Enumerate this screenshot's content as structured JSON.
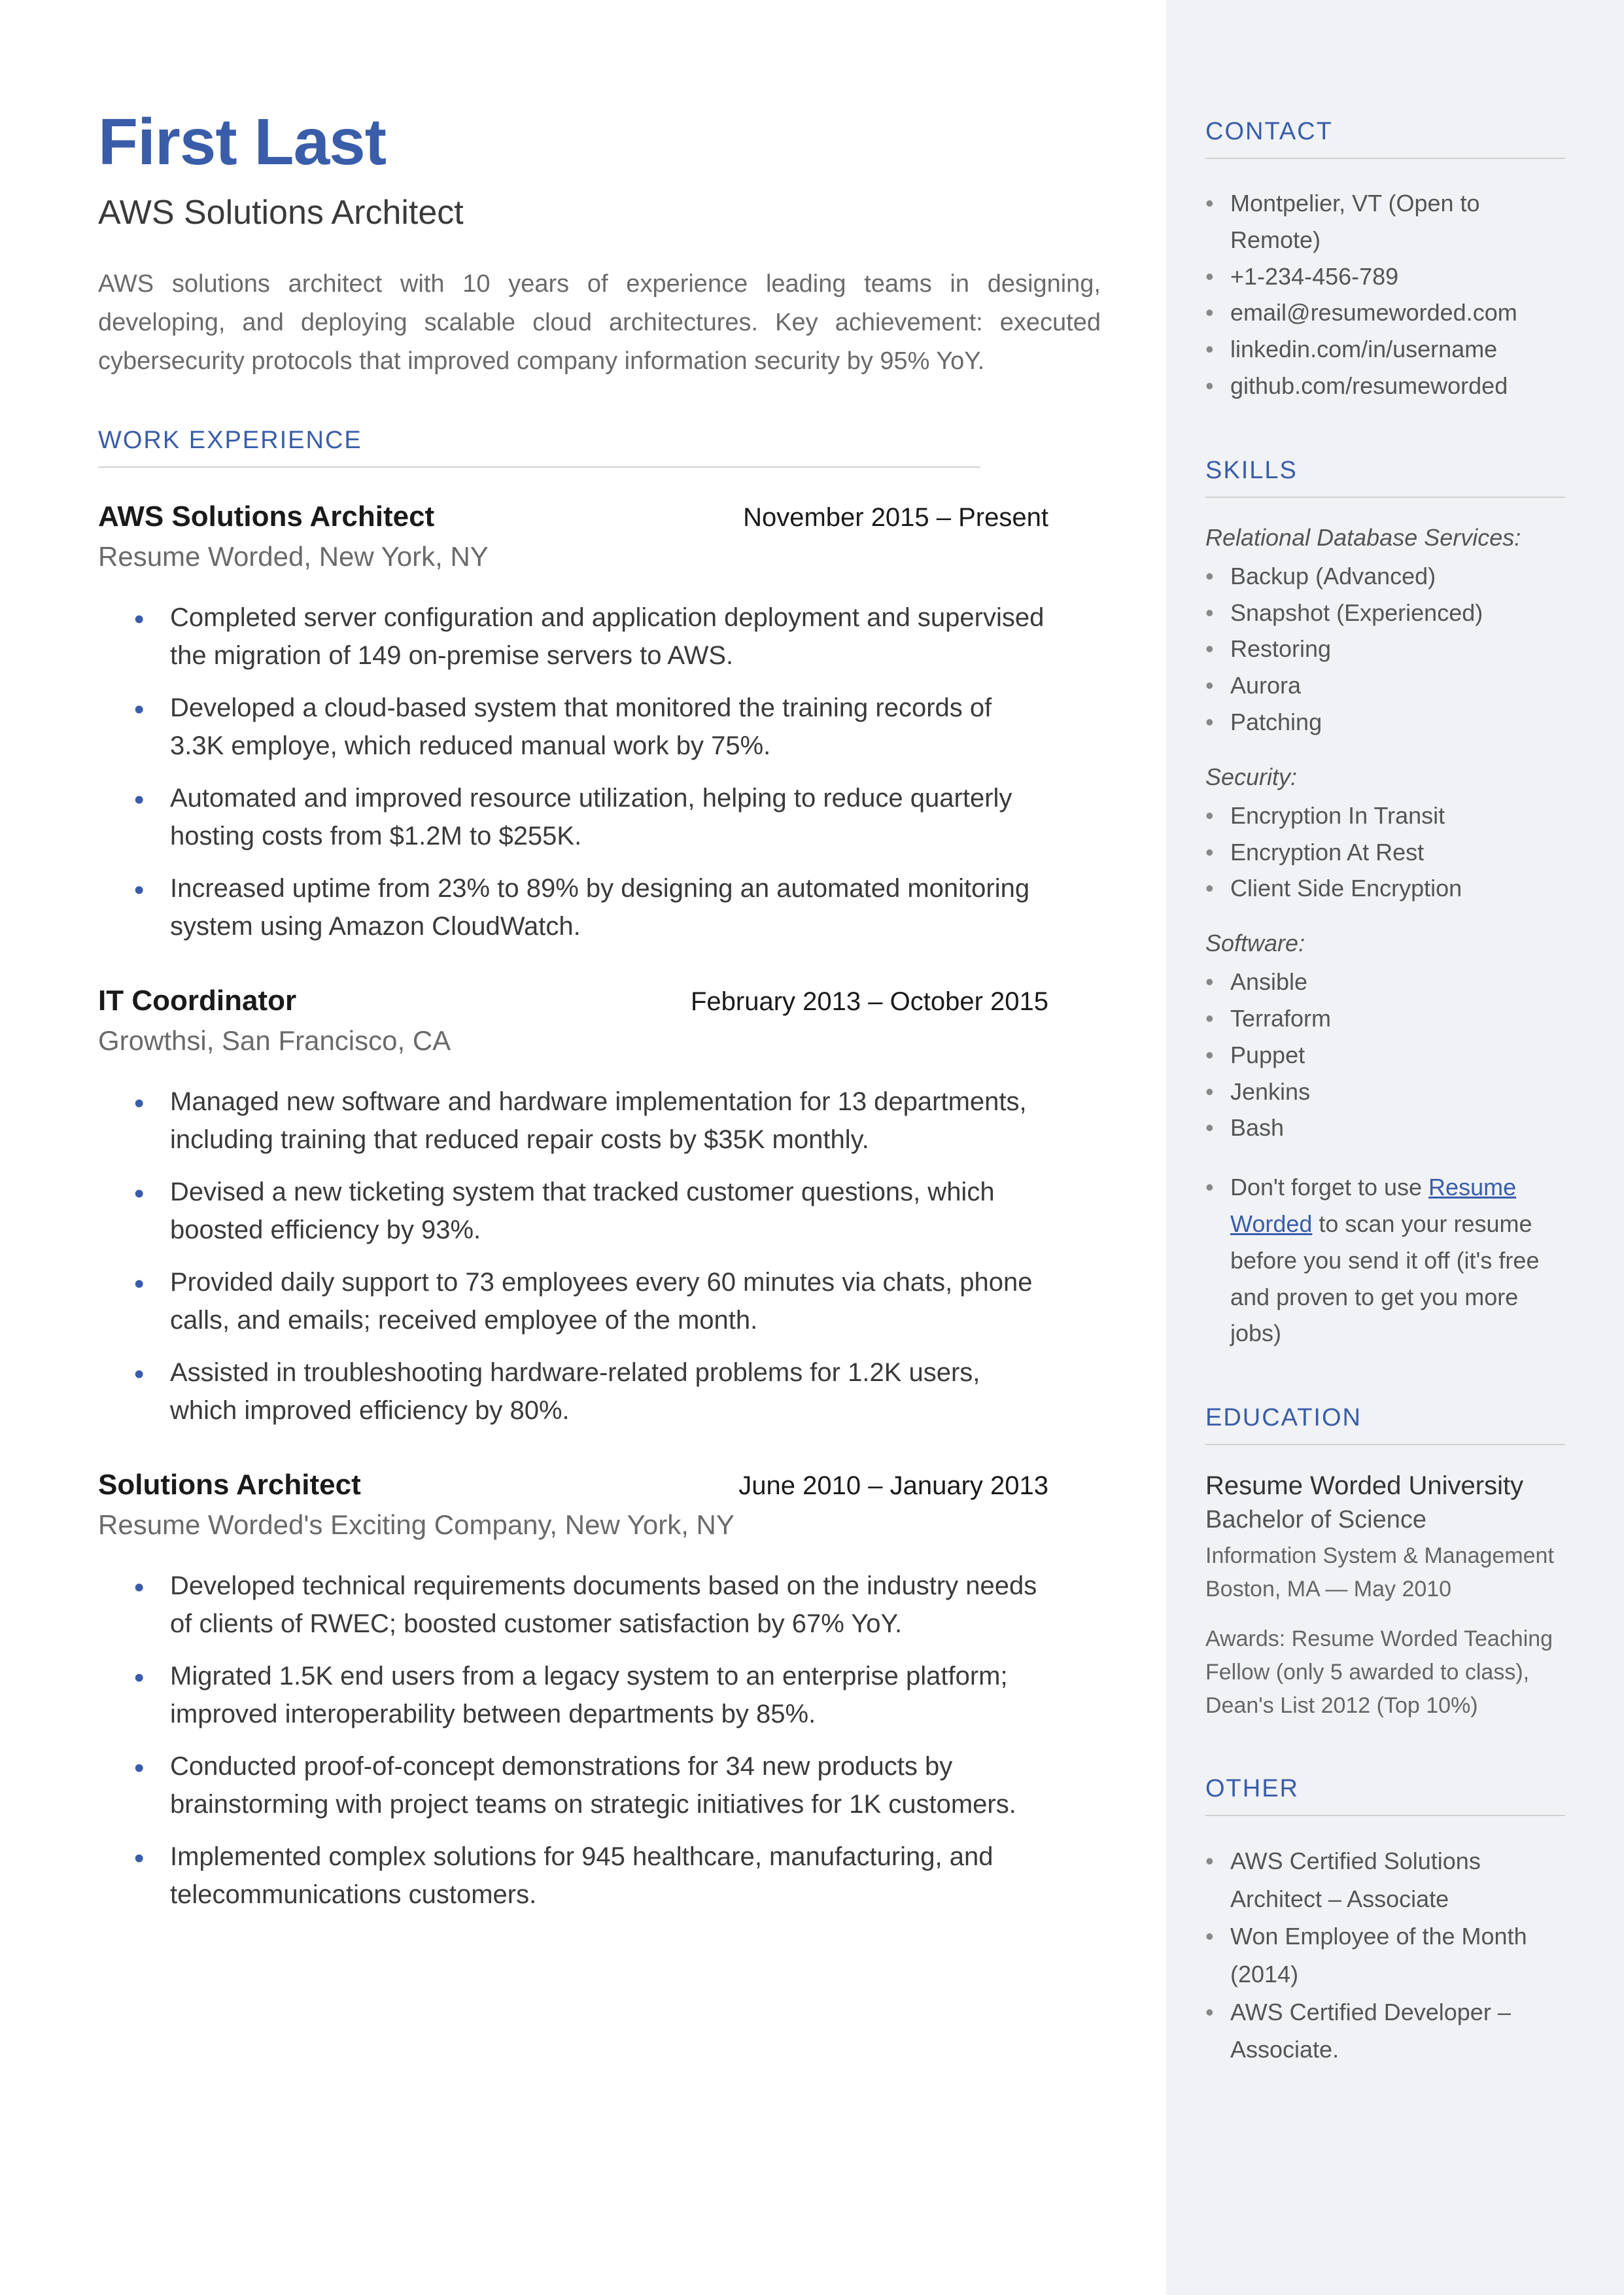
{
  "header": {
    "name": "First Last",
    "title": "AWS Solutions Architect",
    "summary": "AWS solutions architect with 10 years of experience leading teams in designing, developing, and deploying scalable cloud architectures. Key achievement: executed cybersecurity protocols that improved company information security by 95% YoY."
  },
  "sections": {
    "work": "WORK EXPERIENCE",
    "contact": "CONTACT",
    "skills": "SKILLS",
    "education": "EDUCATION",
    "other": "OTHER"
  },
  "jobs": [
    {
      "title": "AWS Solutions Architect",
      "dates": "November 2015 – Present",
      "loc": "Resume Worded, New York, NY",
      "bullets": [
        "Completed server configuration and application deployment and supervised the migration of 149 on-premise servers to AWS.",
        "Developed a cloud-based system that monitored the training records of 3.3K employe, which reduced manual work by 75%.",
        "Automated and improved resource utilization, helping to reduce quarterly hosting costs from $1.2M to $255K.",
        "Increased uptime from 23% to 89% by designing an automated monitoring system using Amazon CloudWatch."
      ]
    },
    {
      "title": "IT Coordinator",
      "dates": "February 2013 – October 2015",
      "loc": "Growthsi, San Francisco, CA",
      "bullets": [
        "Managed new software and hardware implementation for 13 departments, including training that reduced repair costs by $35K monthly.",
        "Devised a new ticketing system that tracked customer questions, which boosted efficiency by 93%.",
        "Provided daily support to 73 employees every 60 minutes via chats, phone calls, and emails; received employee of the month.",
        "Assisted in troubleshooting hardware-related problems for 1.2K users, which improved efficiency by 80%."
      ]
    },
    {
      "title": "Solutions Architect",
      "dates": "June 2010 – January 2013",
      "loc": "Resume Worded's Exciting Company, New York, NY",
      "bullets": [
        "Developed technical requirements documents based on the industry needs of clients of RWEC; boosted customer satisfaction by 67% YoY.",
        "Migrated 1.5K end users from a legacy system to an enterprise platform; improved interoperability between departments by 85%.",
        "Conducted proof-of-concept demonstrations for 34 new products by brainstorming with project teams on strategic initiatives for 1K customers.",
        "Implemented complex solutions for 945 healthcare, manufacturing, and telecommunications customers."
      ]
    }
  ],
  "contact": [
    "Montpelier, VT (Open to Remote)",
    "+1-234-456-789",
    "email@resumeworded.com",
    "linkedin.com/in/username",
    "github.com/resumeworded"
  ],
  "skills": {
    "groups": [
      {
        "h": "Relational Database Services:",
        "items": [
          "Backup (Advanced)",
          "Snapshot (Experienced)",
          "Restoring",
          "Aurora",
          "Patching"
        ]
      },
      {
        "h": "Security:",
        "items": [
          "Encryption In Transit",
          "Encryption At Rest",
          "Client Side Encryption"
        ]
      },
      {
        "h": "Software:",
        "items": [
          "Ansible",
          "Terraform",
          "Puppet",
          "Jenkins",
          "Bash"
        ]
      }
    ],
    "tip_pre": "Don't forget to use ",
    "tip_link": "Resume Worded",
    "tip_post": " to scan your resume before you send it off (it's free and proven to get you more jobs)"
  },
  "education": {
    "school": "Resume Worded University",
    "degree": "Bachelor of Science",
    "sub": "Information System & Management",
    "loc": "Boston, MA — May 2010",
    "awards": "Awards: Resume Worded Teaching Fellow (only 5 awarded to class), Dean's List 2012 (Top 10%)"
  },
  "other": [
    "AWS Certified Solutions Architect – Associate",
    "Won Employee of the Month (2014)",
    "AWS Certified Developer – Associate."
  ]
}
